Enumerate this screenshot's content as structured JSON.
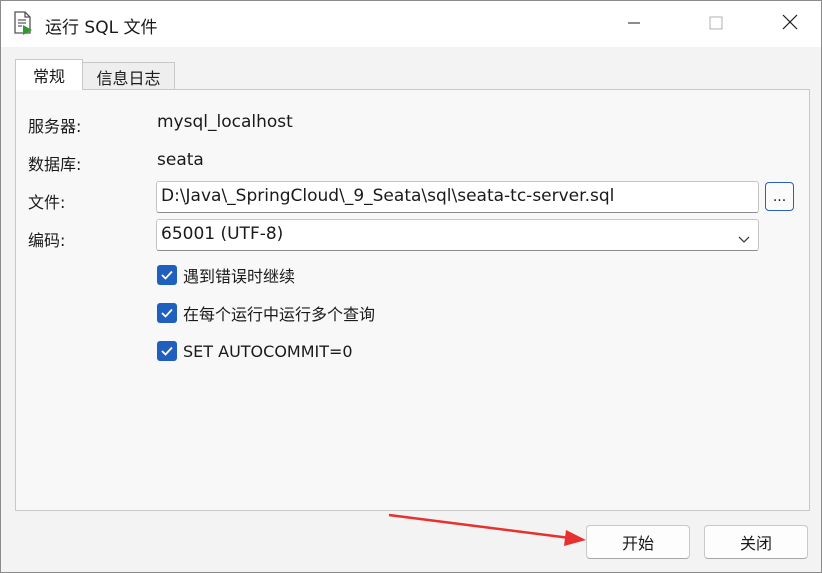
{
  "window": {
    "title": "运行 SQL 文件",
    "icon": "sql-file-run-icon",
    "controls": {
      "minimize": "minimize-icon",
      "maximize": "maximize-icon",
      "close": "close-icon"
    }
  },
  "tabs": [
    {
      "label": "常规",
      "active": true
    },
    {
      "label": "信息日志",
      "active": false
    }
  ],
  "form": {
    "server_label": "服务器:",
    "server_value": "mysql_localhost",
    "database_label": "数据库:",
    "database_value": "seata",
    "file_label": "文件:",
    "file_value": "D:\\Java\\_SpringCloud\\_9_Seata\\sql\\seata-tc-server.sql",
    "browse_label": "...",
    "encoding_label": "编码:",
    "encoding_value": "65001 (UTF-8)"
  },
  "options": [
    {
      "label": "遇到错误时继续",
      "checked": true
    },
    {
      "label": "在每个运行中运行多个查询",
      "checked": true
    },
    {
      "label": "SET AUTOCOMMIT=0",
      "checked": true
    }
  ],
  "buttons": {
    "start_label": "开始",
    "close_label": "关闭"
  },
  "colors": {
    "accent": "#1f5fbf",
    "annotation_arrow": "#e8312e"
  }
}
